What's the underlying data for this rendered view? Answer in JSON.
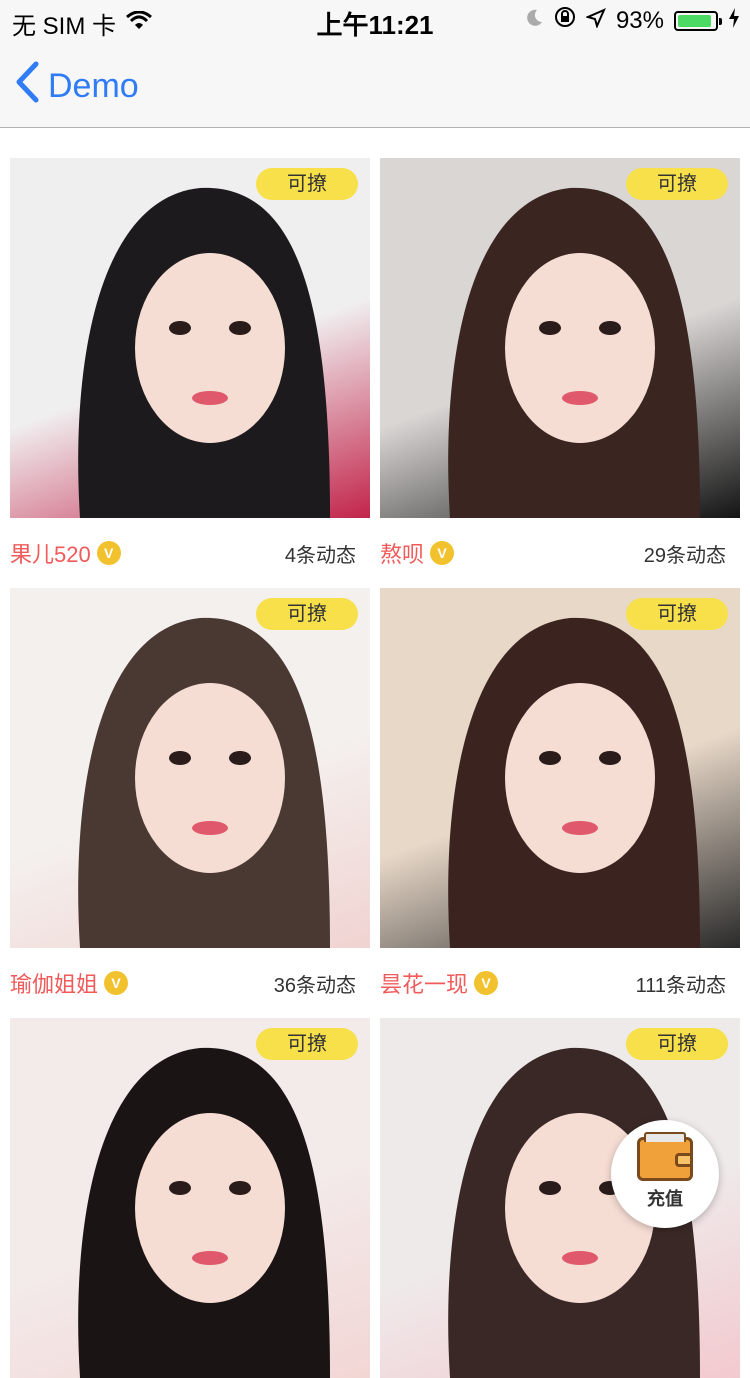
{
  "status_bar": {
    "carrier": "无 SIM 卡",
    "time": "上午11:21",
    "battery_percent": "93%",
    "battery_level": 0.93,
    "icons": [
      "wifi-icon",
      "moon-icon",
      "rotation-lock-icon",
      "location-icon",
      "battery-icon",
      "charging-icon"
    ]
  },
  "nav": {
    "back_label": "Demo"
  },
  "cards": [
    {
      "name": "果儿520",
      "count": "4条动态",
      "tag": "可撩",
      "verified": true,
      "photo_colors": [
        "#f0eff0",
        "#1c1a1c",
        "#c2244a"
      ]
    },
    {
      "name": "熬呗",
      "count": "29条动态",
      "tag": "可撩",
      "verified": true,
      "photo_colors": [
        "#d9d6d4",
        "#3a2520",
        "#141414"
      ]
    },
    {
      "name": "瑜伽姐姐",
      "count": "36条动态",
      "tag": "可撩",
      "verified": true,
      "photo_colors": [
        "#f4f0ee",
        "#4a3833",
        "#f0d3d1"
      ]
    },
    {
      "name": "昙花一现",
      "count": "111条动态",
      "tag": "可撩",
      "verified": true,
      "photo_colors": [
        "#e8d8c8",
        "#3b2420",
        "#2a2a2a"
      ]
    },
    {
      "name": "",
      "count": "",
      "tag": "可撩",
      "verified": false,
      "photo_colors": [
        "#f3eaea",
        "#1a1414",
        "#f2d6d4"
      ]
    },
    {
      "name": "",
      "count": "",
      "tag": "可撩",
      "verified": false,
      "photo_colors": [
        "#efeaea",
        "#3a2826",
        "#f2c9cf"
      ]
    }
  ],
  "verified_badge": "V",
  "recharge": {
    "label": "充值",
    "icon": "wallet-icon"
  }
}
